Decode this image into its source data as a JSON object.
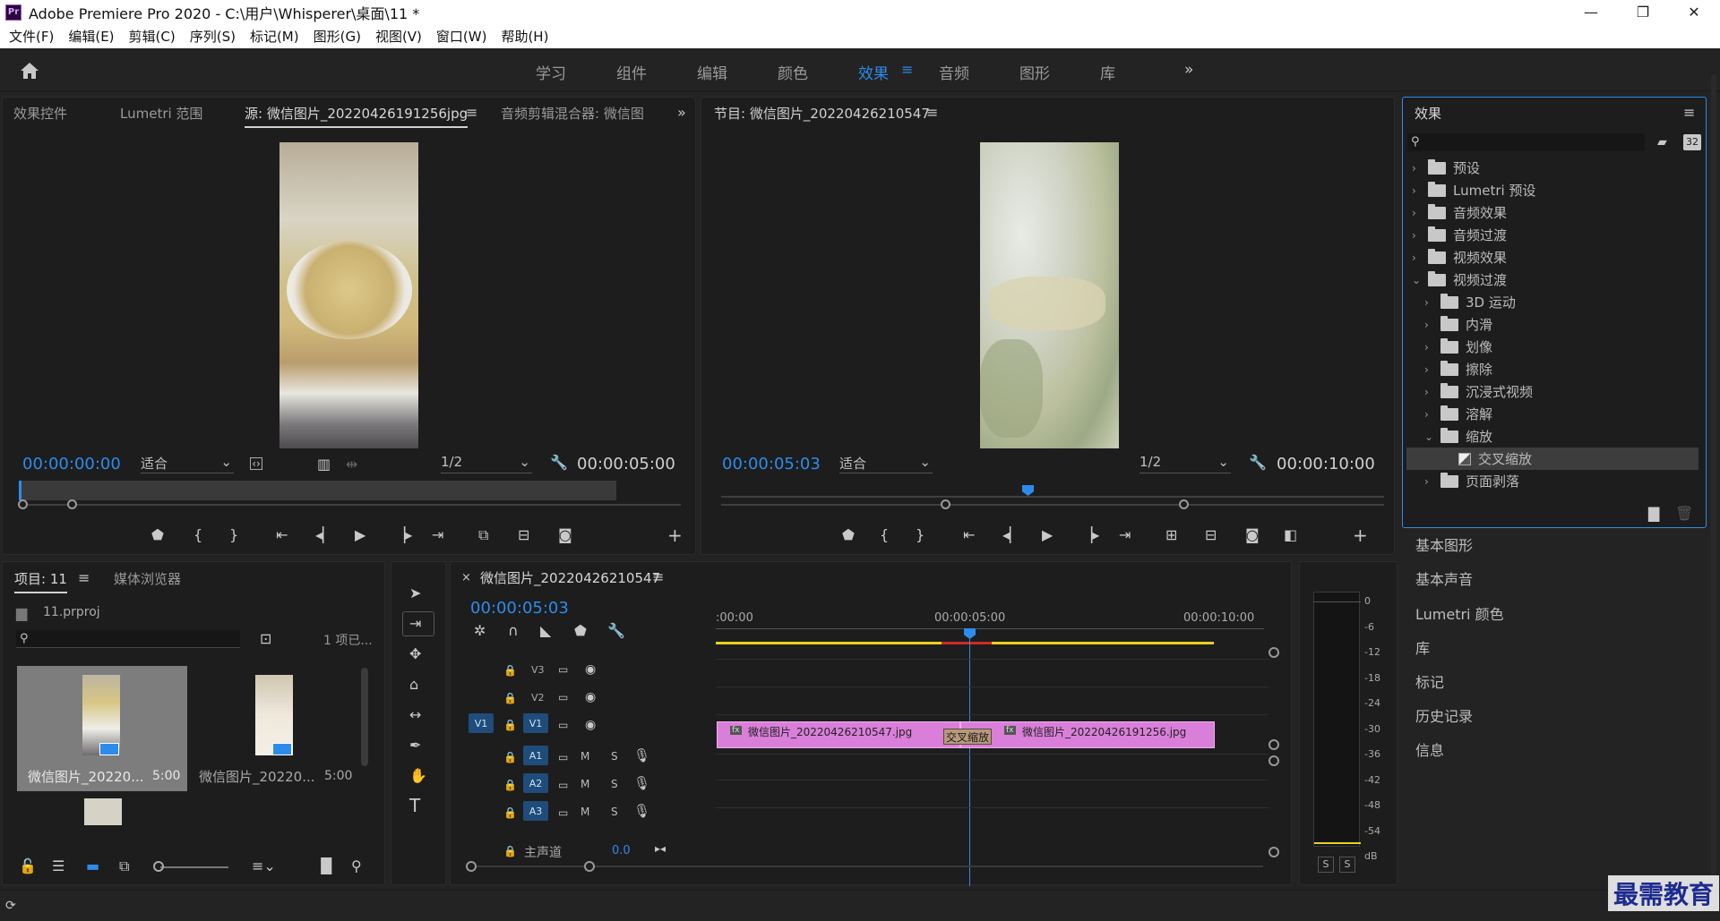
{
  "window": {
    "title": "Adobe Premiere Pro 2020 - C:\\用户\\Whisperer\\桌面\\11 *",
    "app_icon": "Pr",
    "minimize": "—",
    "maximize": "❐",
    "close": "✕"
  },
  "menu": [
    "文件(F)",
    "编辑(E)",
    "剪辑(C)",
    "序列(S)",
    "标记(M)",
    "图形(G)",
    "视图(V)",
    "窗口(W)",
    "帮助(H)"
  ],
  "workspaces": {
    "items": [
      "学习",
      "组件",
      "编辑",
      "颜色",
      "效果",
      "音频",
      "图形",
      "库"
    ],
    "active": "效果",
    "more": "»"
  },
  "source_panel": {
    "tabs": [
      "效果控件",
      "Lumetri 范围",
      "源: 微信图片_20220426191256jpg",
      "音频剪辑混合器: 微信图"
    ],
    "active_tab": "源: 微信图片_20220426191256jpg",
    "timecode_current": "00:00:00:00",
    "fit": "适合",
    "resolution": "1/2",
    "timecode_duration": "00:00:05:00"
  },
  "program_panel": {
    "title": "节目: 微信图片_20220426210547",
    "timecode_current": "00:00:05:03",
    "fit": "适合",
    "resolution": "1/2",
    "timecode_duration": "00:00:10:00"
  },
  "effects_panel": {
    "title": "效果",
    "badges": [
      "32"
    ],
    "tree": [
      {
        "label": "预设",
        "depth": 0,
        "expanded": false,
        "type": "folder-star"
      },
      {
        "label": "Lumetri 预设",
        "depth": 0,
        "expanded": false,
        "type": "folder-star"
      },
      {
        "label": "音频效果",
        "depth": 0,
        "expanded": false,
        "type": "folder"
      },
      {
        "label": "音频过渡",
        "depth": 0,
        "expanded": false,
        "type": "folder"
      },
      {
        "label": "视频效果",
        "depth": 0,
        "expanded": false,
        "type": "folder"
      },
      {
        "label": "视频过渡",
        "depth": 0,
        "expanded": true,
        "type": "folder"
      },
      {
        "label": "3D 运动",
        "depth": 1,
        "expanded": false,
        "type": "folder"
      },
      {
        "label": "内滑",
        "depth": 1,
        "expanded": false,
        "type": "folder"
      },
      {
        "label": "划像",
        "depth": 1,
        "expanded": false,
        "type": "folder"
      },
      {
        "label": "擦除",
        "depth": 1,
        "expanded": false,
        "type": "folder"
      },
      {
        "label": "沉浸式视频",
        "depth": 1,
        "expanded": false,
        "type": "folder"
      },
      {
        "label": "溶解",
        "depth": 1,
        "expanded": false,
        "type": "folder"
      },
      {
        "label": "缩放",
        "depth": 1,
        "expanded": true,
        "type": "folder"
      },
      {
        "label": "交叉缩放",
        "depth": 2,
        "expanded": false,
        "type": "effect",
        "selected": true
      },
      {
        "label": "页面剥落",
        "depth": 1,
        "expanded": false,
        "type": "folder"
      }
    ]
  },
  "side_panels": [
    "基本图形",
    "基本声音",
    "Lumetri 颜色",
    "库",
    "标记",
    "历史记录",
    "信息"
  ],
  "project_panel": {
    "tabs": [
      "项目: 11",
      "媒体浏览器"
    ],
    "project_file": "11.prproj",
    "item_count": "1 项已...",
    "items": [
      {
        "name": "微信图片_20220...",
        "duration": "5:00",
        "selected": true
      },
      {
        "name": "微信图片_20220...",
        "duration": "5:00",
        "selected": false
      }
    ]
  },
  "timeline": {
    "title": "微信图片_20220426210547",
    "timecode": "00:00:05:03",
    "ruler": [
      ":00:00",
      "00:00:05:00",
      "00:00:10:00"
    ],
    "video_tracks": [
      "V3",
      "V2",
      "V1"
    ],
    "audio_tracks": [
      "A1",
      "A2",
      "A3"
    ],
    "source_patch": "V1",
    "master": {
      "label": "主声道",
      "value": "0.0"
    },
    "clips": [
      {
        "label": "微信图片_20220426210547.jpg",
        "fx": "fx"
      },
      {
        "label": "微信图片_20220426191256.jpg",
        "fx": "fx"
      }
    ],
    "transition": "交叉缩放",
    "track_labels": {
      "mute": "M",
      "solo": "S"
    }
  },
  "meter": {
    "scale": [
      "0",
      "-6",
      "-12",
      "-18",
      "-24",
      "-30",
      "-36",
      "-42",
      "-48",
      "-54",
      "dB"
    ],
    "solo": [
      "S",
      "S"
    ]
  },
  "watermark": "最需教育",
  "colors": {
    "accent": "#2d8ceb",
    "clip": "#d97fd9",
    "playhead": "#2d8ceb",
    "work_area": "#e6d21e"
  }
}
